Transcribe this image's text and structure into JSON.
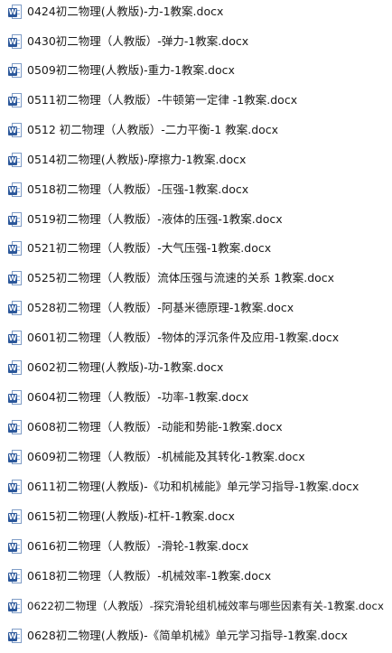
{
  "file_icon": {
    "name": "word-document-icon",
    "glyph": "W",
    "color": "#2b579a"
  },
  "files": [
    {
      "name": "0424初二物理(人教版)-力-1教案.docx"
    },
    {
      "name": "0430初二物理（人教版）-弹力-1教案.docx"
    },
    {
      "name": "0509初二物理(人教版)-重力-1教案.docx"
    },
    {
      "name": "0511初二物理（人教版）-牛顿第一定律 -1教案.docx"
    },
    {
      "name": "0512 初二物理（人教版）-二力平衡-1 教案.docx"
    },
    {
      "name": "0514初二物理(人教版)-摩擦力-1教案.docx"
    },
    {
      "name": "0518初二物理（人教版）-压强-1教案.docx"
    },
    {
      "name": "0519初二物理（人教版）-液体的压强-1教案.docx"
    },
    {
      "name": "0521初二物理（人教版）-大气压强-1教案.docx"
    },
    {
      "name": "0525初二物理（人教版）流体压强与流速的关系 1教案.docx"
    },
    {
      "name": "0528初二物理（人教版）-阿基米德原理-1教案.docx"
    },
    {
      "name": "0601初二物理（人教版）-物体的浮沉条件及应用-1教案.docx"
    },
    {
      "name": "0602初二物理(人教版)-功-1教案.docx"
    },
    {
      "name": "0604初二物理（人教版）-功率-1教案.docx"
    },
    {
      "name": "0608初二物理（人教版）-动能和势能-1教案.docx"
    },
    {
      "name": "0609初二物理（人教版）-机械能及其转化-1教案.docx"
    },
    {
      "name": "0611初二物理(人教版)-《功和机械能》单元学习指导-1教案.docx"
    },
    {
      "name": "0615初二物理(人教版)-杠杆-1教案.docx"
    },
    {
      "name": "0616初二物理（人教版）-滑轮-1教案.docx"
    },
    {
      "name": "0618初二物理（人教版）-机械效率-1教案.docx"
    },
    {
      "name": "0622初二物理（人教版）-探究滑轮组机械效率与哪些因素有关-1教案.docx"
    },
    {
      "name": "0628初二物理(人教版)-《简单机械》单元学习指导-1教案.docx"
    }
  ]
}
